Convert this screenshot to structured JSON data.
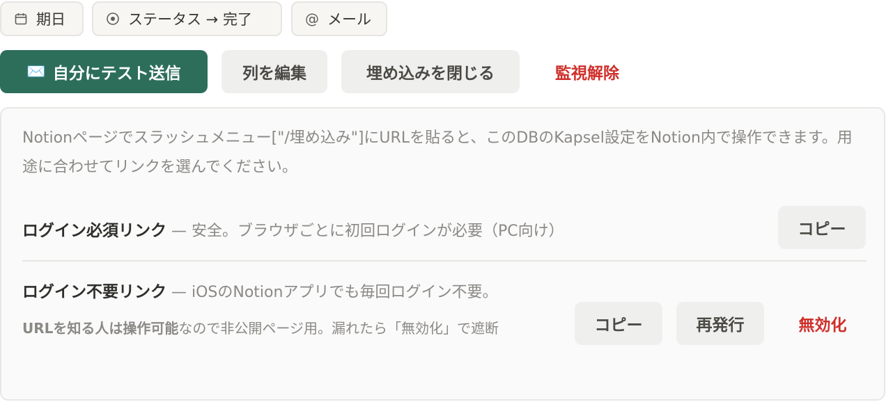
{
  "filters": [
    {
      "icon": "calendar-icon",
      "label": "期日"
    },
    {
      "icon": "status-target-icon",
      "label": "ステータス → 完了"
    },
    {
      "icon": "at-icon",
      "label": "メール",
      "glyph": "@"
    }
  ],
  "actions": {
    "send_test_icon": "✉️",
    "send_test": "自分にテスト送信",
    "edit_columns": "列を編集",
    "close_embed": "埋め込みを閉じる",
    "unwatch": "監視解除"
  },
  "panel": {
    "description": "Notionページでスラッシュメニュー[\"/埋め込み\"]にURLを貼ると、このDBのKapsel設定をNotion内で操作できます。用途に合わせてリンクを選んでください。",
    "login_required": {
      "title": "ログイン必須リンク",
      "detail": " — 安全。ブラウザごとに初回ログインが必要（PC向け）",
      "copy": "コピー"
    },
    "no_login": {
      "title": "ログイン不要リンク",
      "detail": " — iOSのNotionアプリでも毎回ログイン不要。",
      "warning_strong": "URLを知る人は操作可能",
      "warning_rest": "なので非公開ページ用。漏れたら「無効化」で遮断",
      "copy": "コピー",
      "reissue": "再発行",
      "disable": "無効化"
    }
  },
  "colors": {
    "primary": "#2d6e5a",
    "danger": "#cf2f2a",
    "button_bg": "#efefed"
  }
}
